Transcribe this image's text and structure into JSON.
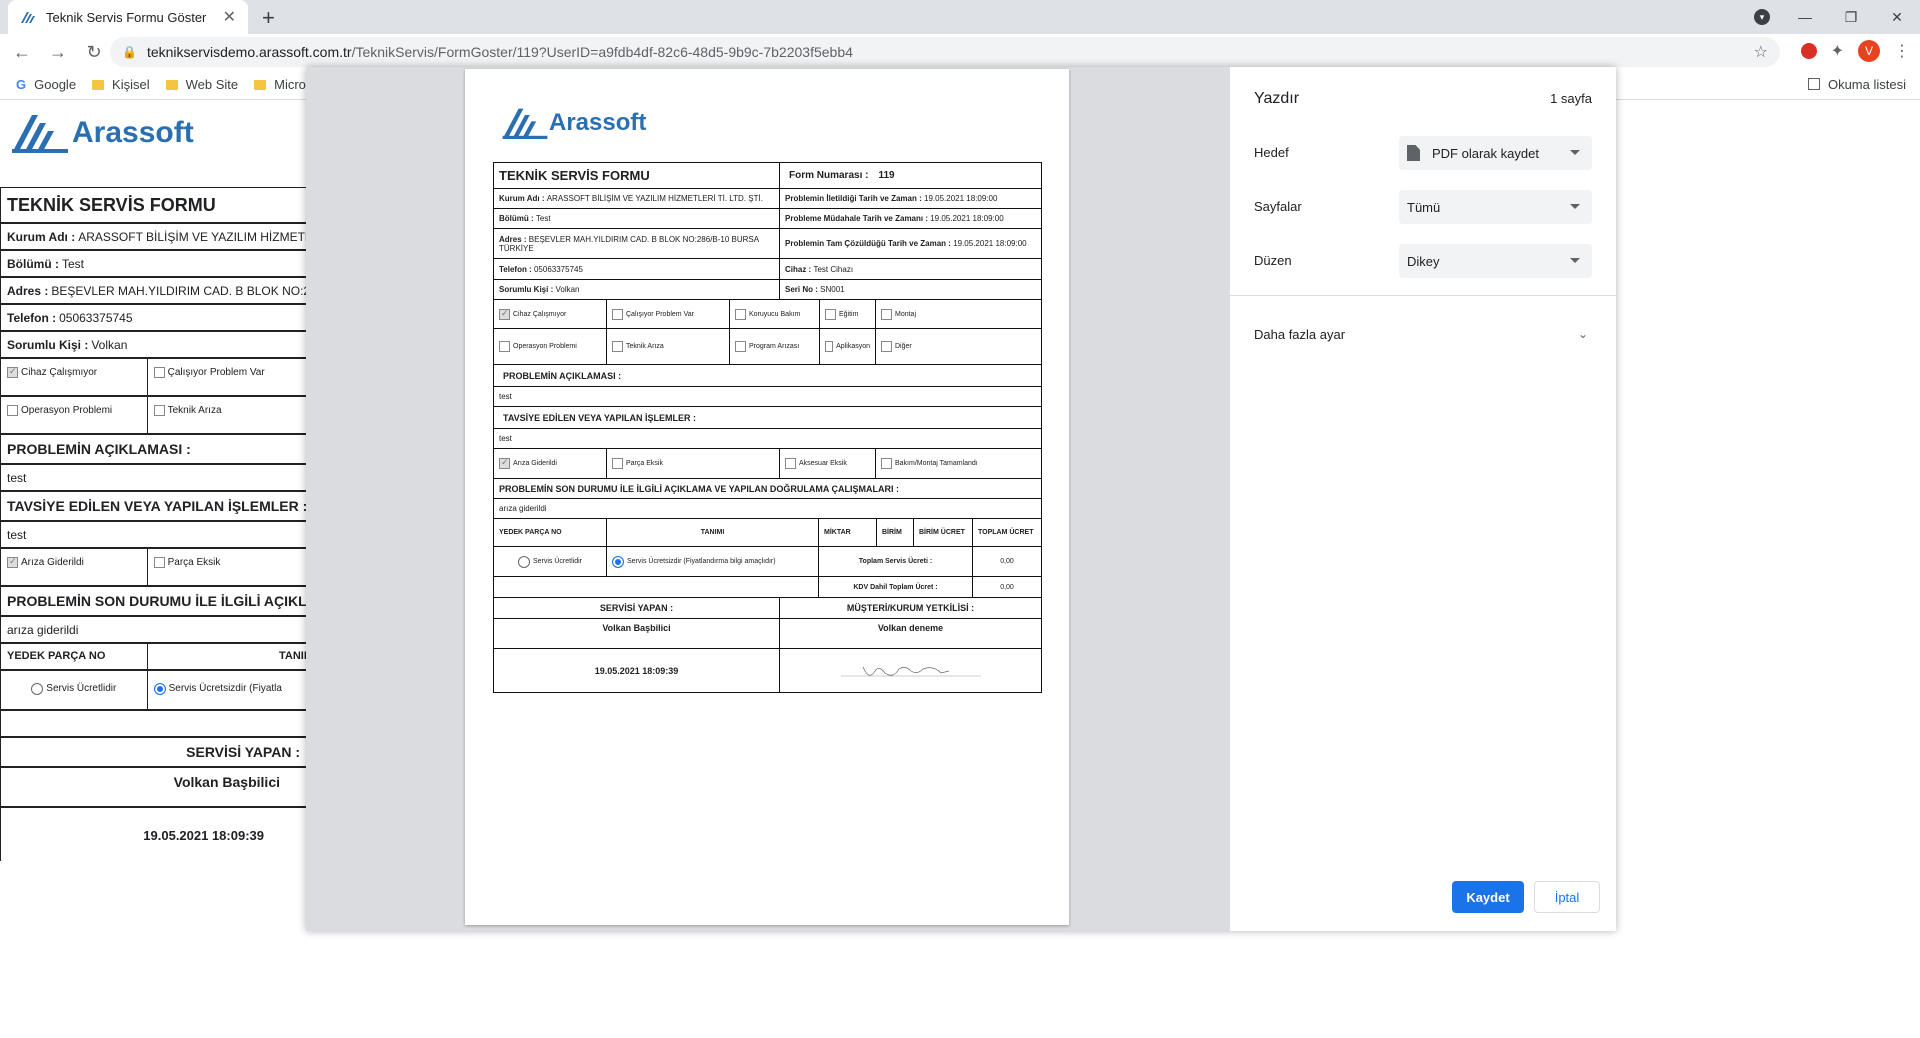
{
  "browser": {
    "tab_title": "Teknik Servis Formu Göster",
    "url_host": "teknikservisdemo.arassoft.com.tr",
    "url_path": "/TeknikServis/FormGoster/119?UserID=a9fdb4df-82c6-48d5-9b9c-7b2203f5ebb4",
    "profile_initial": "V",
    "bookmarks": [
      "Google",
      "Kişisel",
      "Web Site",
      "Micro"
    ],
    "reading_list": "Okuma listesi"
  },
  "logo_text": "Arassoft",
  "form": {
    "title": "TEKNİK SERVİS FORMU",
    "form_no_label": "Form Numarası :",
    "form_no": "119",
    "company_label": "Kurum Adı :",
    "company": "ARASSOFT BİLİŞİM VE YAZILIM HİZMETLERİ Tİ. LTD. ŞTİ.",
    "company_bg": "ARASSOFT BİLİŞİM VE YAZILIM HİZMETLERİ Tİ. LT",
    "dept_label": "Bölümü :",
    "dept": "Test",
    "address_label": "Adres :",
    "address": "BEŞEVLER MAH.YILDIRIM CAD. B BLOK NO:286/B-10 BURSA TÜRKİYE",
    "address_bg": "BEŞEVLER MAH.YILDIRIM CAD. B BLOK NO:286/B-10 B",
    "phone_label": "Telefon :",
    "phone": "05063375745",
    "contact_label": "Sorumlu Kişi :",
    "contact": "Volkan",
    "reported_label": "Problemin İletildiği Tarih ve Zaman :",
    "reported": "19.05.2021 18:09:00",
    "intervention_label": "Probleme Müdahale Tarih ve Zamanı :",
    "intervention": "19.05.2021 18:09:00",
    "resolved_label": "Problemin Tam Çözüldüğü Tarih ve Zaman :",
    "resolved": "19.05.2021 18:09:00",
    "device_label": "Cihaz :",
    "device": "Test Cihazı",
    "serial_label": "Seri No :",
    "serial": "SN001",
    "problem_types": [
      [
        "Cihaz Çalışmıyor",
        "Çalışıyor Problem Var",
        "Koruyucu Bakım",
        "Eğitim",
        "Montaj"
      ],
      [
        "Operasyon Problemi",
        "Teknik Arıza",
        "Program Arızası",
        "Aplikasyon",
        "Diğer"
      ]
    ],
    "problem_desc_label": "PROBLEMİN AÇIKLAMASI :",
    "problem_desc": "test",
    "actions_label": "TAVSİYE EDİLEN VEYA YAPILAN İŞLEMLER :",
    "actions": "test",
    "results": [
      "Arıza Giderildi",
      "Parça Eksik",
      "Aksesuar Eksik",
      "Bakım/Montaj Tamamlandı"
    ],
    "final_label": "PROBLEMİN SON DURUMU İLE İLGİLİ AÇIKLAMA VE YAPILAN DOĞRULAMA ÇALIŞMALARI :",
    "final_label_bg": "PROBLEMİN SON DURUMU İLE İLGİLİ AÇIKLAMA VE",
    "final": "arıza giderildi",
    "parts_headers": [
      "YEDEK PARÇA NO",
      "TANIMI",
      "MİKTAR",
      "BİRİM",
      "BİRİM ÜCRET",
      "TOPLAM ÜCRET"
    ],
    "parts_header_bg": "TANIM",
    "paid_label": "Servis Ücretlidir",
    "free_label": "Servis Ücretsizdir (Fiyatlandırma bilgi amaçlıdır)",
    "free_label_bg": "Servis Ücretsizdir (Fiyatla",
    "total_service_label": "Toplam Servis Ücreti :",
    "total_service": "0,00",
    "total_kdv_label": "KDV Dahil Toplam Ücret :",
    "total_kdv": "0,00",
    "servicer_label": "SERVİSİ YAPAN :",
    "servicer": "Volkan Başbilici",
    "customer_label": "MÜŞTERİ/KURUM YETKİLİSİ :",
    "customer": "Volkan deneme",
    "date": "19.05.2021 18:09:39"
  },
  "print": {
    "title": "Yazdır",
    "pages_count": "1 sayfa",
    "destination_label": "Hedef",
    "destination": "PDF olarak kaydet",
    "pages_label": "Sayfalar",
    "pages": "Tümü",
    "layout_label": "Düzen",
    "layout": "Dikey",
    "more_settings": "Daha fazla ayar",
    "save": "Kaydet",
    "cancel": "İptal"
  },
  "colors": {
    "accent": "#1a73e8",
    "brand": "#2a6fb1"
  }
}
